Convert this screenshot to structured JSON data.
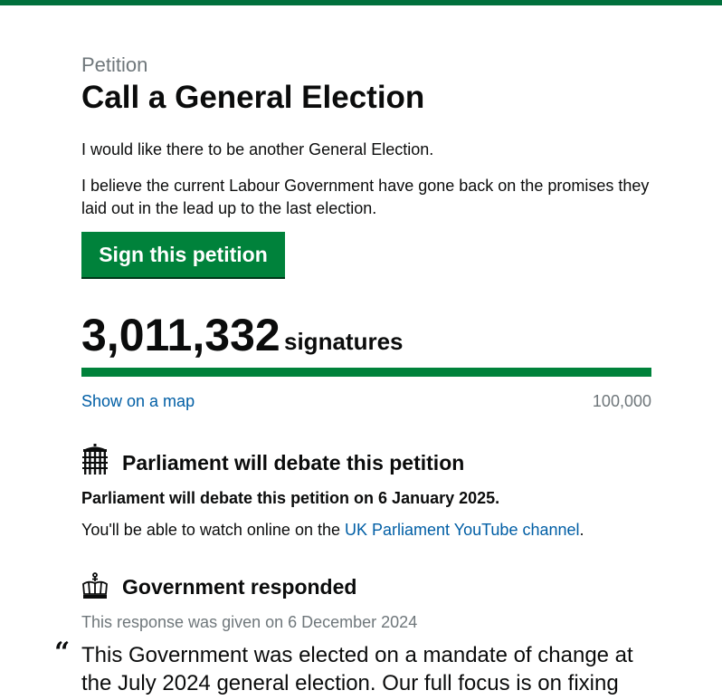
{
  "theme": {
    "accent": "#00703c",
    "button": "#00823b",
    "link": "#005ea5",
    "muted": "#6f777b"
  },
  "petition": {
    "caption": "Petition",
    "title": "Call a General Election",
    "paragraph_1": "I would like there to be another General Election.",
    "paragraph_2": "I believe the current Labour Government have gone back on the promises they laid out in the lead up to the last election.",
    "sign_button": "Sign this petition"
  },
  "signatures": {
    "count": "3,011,332",
    "label": "signatures",
    "progress_fraction": 1.0,
    "map_link": "Show on a map",
    "threshold": "100,000"
  },
  "debate": {
    "icon": "portcullis-icon",
    "heading": "Parliament will debate this petition",
    "date_text": "Parliament will debate this petition on 6 January 2025.",
    "watch_prefix": "You'll be able to watch online on the ",
    "watch_link": "UK Parliament YouTube channel",
    "watch_suffix": "."
  },
  "response": {
    "icon": "crown-icon",
    "heading": "Government responded",
    "given_date": "This response was given on 6 December 2024",
    "quote_mark": "“",
    "quote": "This Government was elected on a mandate of change at the July 2024 general election. Our full focus is on fixing"
  }
}
